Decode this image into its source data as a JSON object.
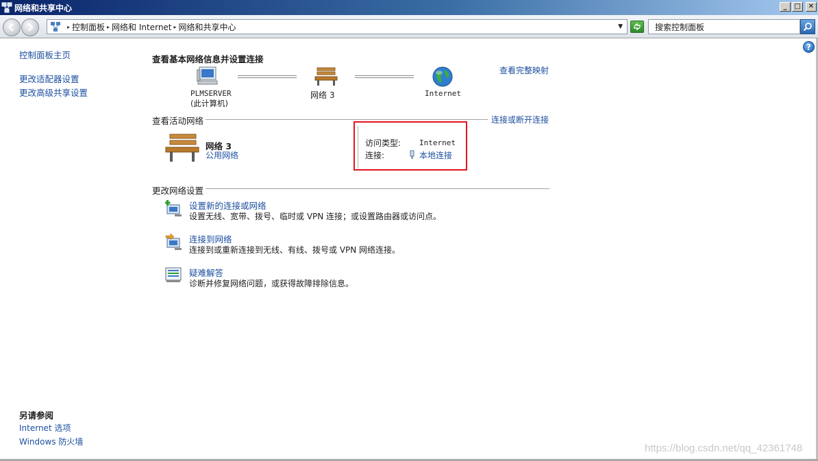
{
  "window": {
    "title": "网络和共享中心",
    "minimize": "_",
    "restore": "□",
    "close": "✕"
  },
  "address": {
    "breadcrumb": [
      "控制面板",
      "网络和 Internet",
      "网络和共享中心"
    ],
    "search_placeholder": "搜索控制面板"
  },
  "sidebar": {
    "home": "控制面板主页",
    "links": [
      "更改适配器设置",
      "更改高级共享设置"
    ],
    "see_also_title": "另请参阅",
    "see_also": [
      "Internet 选项",
      "Windows 防火墙"
    ]
  },
  "main": {
    "heading": "查看基本网络信息并设置连接",
    "view_full_map": "查看完整映射",
    "map": {
      "computer_name": "PLMSERVER",
      "computer_sub": "(此计算机)",
      "network_name": "网络  3",
      "internet": "Internet"
    },
    "active_networks": {
      "title": "查看活动网络",
      "connect_link": "连接或断开连接",
      "network_name": "网络  3",
      "network_type": "公用网络",
      "access_type_label": "访问类型:",
      "access_type_value": "Internet",
      "connection_label": "连接:",
      "connection_value": "本地连接"
    },
    "change_settings": {
      "title": "更改网络设置",
      "tasks": [
        {
          "title": "设置新的连接或网络",
          "desc": "设置无线、宽带、拨号、临时或 VPN 连接；或设置路由器或访问点。"
        },
        {
          "title": "连接到网络",
          "desc": "连接到或重新连接到无线、有线、拨号或 VPN 网络连接。"
        },
        {
          "title": "疑难解答",
          "desc": "诊断并修复网络问题，或获得故障排除信息。"
        }
      ]
    }
  },
  "watermark": "https://blog.csdn.net/qq_42361748",
  "help": "?"
}
